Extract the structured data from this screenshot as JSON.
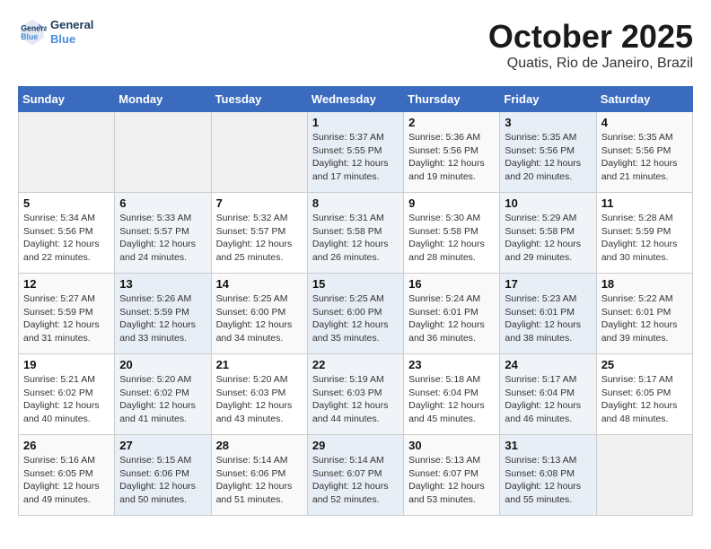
{
  "header": {
    "logo_line1": "General",
    "logo_line2": "Blue",
    "month": "October 2025",
    "location": "Quatis, Rio de Janeiro, Brazil"
  },
  "weekdays": [
    "Sunday",
    "Monday",
    "Tuesday",
    "Wednesday",
    "Thursday",
    "Friday",
    "Saturday"
  ],
  "weeks": [
    [
      {
        "day": "",
        "info": ""
      },
      {
        "day": "",
        "info": ""
      },
      {
        "day": "",
        "info": ""
      },
      {
        "day": "1",
        "info": "Sunrise: 5:37 AM\nSunset: 5:55 PM\nDaylight: 12 hours\nand 17 minutes."
      },
      {
        "day": "2",
        "info": "Sunrise: 5:36 AM\nSunset: 5:56 PM\nDaylight: 12 hours\nand 19 minutes."
      },
      {
        "day": "3",
        "info": "Sunrise: 5:35 AM\nSunset: 5:56 PM\nDaylight: 12 hours\nand 20 minutes."
      },
      {
        "day": "4",
        "info": "Sunrise: 5:35 AM\nSunset: 5:56 PM\nDaylight: 12 hours\nand 21 minutes."
      }
    ],
    [
      {
        "day": "5",
        "info": "Sunrise: 5:34 AM\nSunset: 5:56 PM\nDaylight: 12 hours\nand 22 minutes."
      },
      {
        "day": "6",
        "info": "Sunrise: 5:33 AM\nSunset: 5:57 PM\nDaylight: 12 hours\nand 24 minutes."
      },
      {
        "day": "7",
        "info": "Sunrise: 5:32 AM\nSunset: 5:57 PM\nDaylight: 12 hours\nand 25 minutes."
      },
      {
        "day": "8",
        "info": "Sunrise: 5:31 AM\nSunset: 5:58 PM\nDaylight: 12 hours\nand 26 minutes."
      },
      {
        "day": "9",
        "info": "Sunrise: 5:30 AM\nSunset: 5:58 PM\nDaylight: 12 hours\nand 28 minutes."
      },
      {
        "day": "10",
        "info": "Sunrise: 5:29 AM\nSunset: 5:58 PM\nDaylight: 12 hours\nand 29 minutes."
      },
      {
        "day": "11",
        "info": "Sunrise: 5:28 AM\nSunset: 5:59 PM\nDaylight: 12 hours\nand 30 minutes."
      }
    ],
    [
      {
        "day": "12",
        "info": "Sunrise: 5:27 AM\nSunset: 5:59 PM\nDaylight: 12 hours\nand 31 minutes."
      },
      {
        "day": "13",
        "info": "Sunrise: 5:26 AM\nSunset: 5:59 PM\nDaylight: 12 hours\nand 33 minutes."
      },
      {
        "day": "14",
        "info": "Sunrise: 5:25 AM\nSunset: 6:00 PM\nDaylight: 12 hours\nand 34 minutes."
      },
      {
        "day": "15",
        "info": "Sunrise: 5:25 AM\nSunset: 6:00 PM\nDaylight: 12 hours\nand 35 minutes."
      },
      {
        "day": "16",
        "info": "Sunrise: 5:24 AM\nSunset: 6:01 PM\nDaylight: 12 hours\nand 36 minutes."
      },
      {
        "day": "17",
        "info": "Sunrise: 5:23 AM\nSunset: 6:01 PM\nDaylight: 12 hours\nand 38 minutes."
      },
      {
        "day": "18",
        "info": "Sunrise: 5:22 AM\nSunset: 6:01 PM\nDaylight: 12 hours\nand 39 minutes."
      }
    ],
    [
      {
        "day": "19",
        "info": "Sunrise: 5:21 AM\nSunset: 6:02 PM\nDaylight: 12 hours\nand 40 minutes."
      },
      {
        "day": "20",
        "info": "Sunrise: 5:20 AM\nSunset: 6:02 PM\nDaylight: 12 hours\nand 41 minutes."
      },
      {
        "day": "21",
        "info": "Sunrise: 5:20 AM\nSunset: 6:03 PM\nDaylight: 12 hours\nand 43 minutes."
      },
      {
        "day": "22",
        "info": "Sunrise: 5:19 AM\nSunset: 6:03 PM\nDaylight: 12 hours\nand 44 minutes."
      },
      {
        "day": "23",
        "info": "Sunrise: 5:18 AM\nSunset: 6:04 PM\nDaylight: 12 hours\nand 45 minutes."
      },
      {
        "day": "24",
        "info": "Sunrise: 5:17 AM\nSunset: 6:04 PM\nDaylight: 12 hours\nand 46 minutes."
      },
      {
        "day": "25",
        "info": "Sunrise: 5:17 AM\nSunset: 6:05 PM\nDaylight: 12 hours\nand 48 minutes."
      }
    ],
    [
      {
        "day": "26",
        "info": "Sunrise: 5:16 AM\nSunset: 6:05 PM\nDaylight: 12 hours\nand 49 minutes."
      },
      {
        "day": "27",
        "info": "Sunrise: 5:15 AM\nSunset: 6:06 PM\nDaylight: 12 hours\nand 50 minutes."
      },
      {
        "day": "28",
        "info": "Sunrise: 5:14 AM\nSunset: 6:06 PM\nDaylight: 12 hours\nand 51 minutes."
      },
      {
        "day": "29",
        "info": "Sunrise: 5:14 AM\nSunset: 6:07 PM\nDaylight: 12 hours\nand 52 minutes."
      },
      {
        "day": "30",
        "info": "Sunrise: 5:13 AM\nSunset: 6:07 PM\nDaylight: 12 hours\nand 53 minutes."
      },
      {
        "day": "31",
        "info": "Sunrise: 5:13 AM\nSunset: 6:08 PM\nDaylight: 12 hours\nand 55 minutes."
      },
      {
        "day": "",
        "info": ""
      }
    ]
  ]
}
